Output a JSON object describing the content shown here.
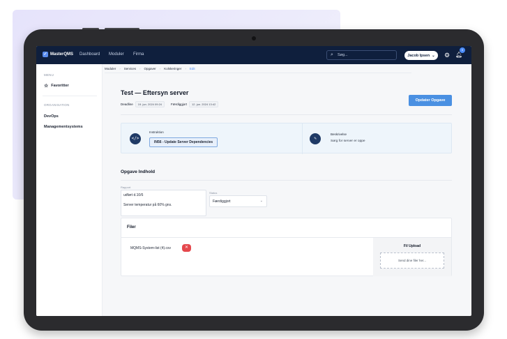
{
  "app": {
    "brand": "MasterQMS"
  },
  "topbar": {
    "nav": [
      "Dashboard",
      "Moduler",
      "Firma"
    ],
    "search_placeholder": "Søg...",
    "user_name": "Jacob Ipsen",
    "notification_count": "0"
  },
  "sidebar": {
    "menu_label": "MENU",
    "favorites": "Favoritter",
    "org_label": "ORGANISATION",
    "items": [
      "DevOps",
      "Managementsystems"
    ]
  },
  "breadcrumb": [
    "Moduler",
    "Services",
    "Opgaver",
    "Kolskeringer",
    "Edit"
  ],
  "task": {
    "title": "Test — Eftersyn server",
    "deadline_label": "Deadline",
    "deadline_value": "19. jun. 2024 09:24",
    "done_label": "Færdiggjort",
    "done_value": "12. jun. 2024 13:42",
    "update_button": "Opdater Opgave"
  },
  "info": {
    "instruction_label": "Instruktion",
    "instruction_tag": "IN56 - Update Server Dependencies",
    "description_label": "Beskrivelse",
    "description_text": "Sørg for server er oppe"
  },
  "content": {
    "section_title": "Opgave Indhold",
    "report_label": "Rapport",
    "report_line1": "udført d.10/6",
    "report_line2": "Server temperatur på 60% gns.",
    "status_label": "Status",
    "status_value": "Færdiggjort"
  },
  "files": {
    "title": "Filer",
    "file_name": "MQMS-System-list (4).csv",
    "upload_title": "Fil Upload",
    "dropzone_text": "Send dine filer her..."
  },
  "icons": {
    "instruction": "code-file-icon",
    "description": "document-edit-icon",
    "favorites": "star-icon",
    "search": "search-icon",
    "settings": "gear-icon",
    "notifications": "bell-icon"
  },
  "colors": {
    "topbar": "#0f1f3d",
    "accent": "#4a90e2",
    "delete": "#e5484d"
  }
}
